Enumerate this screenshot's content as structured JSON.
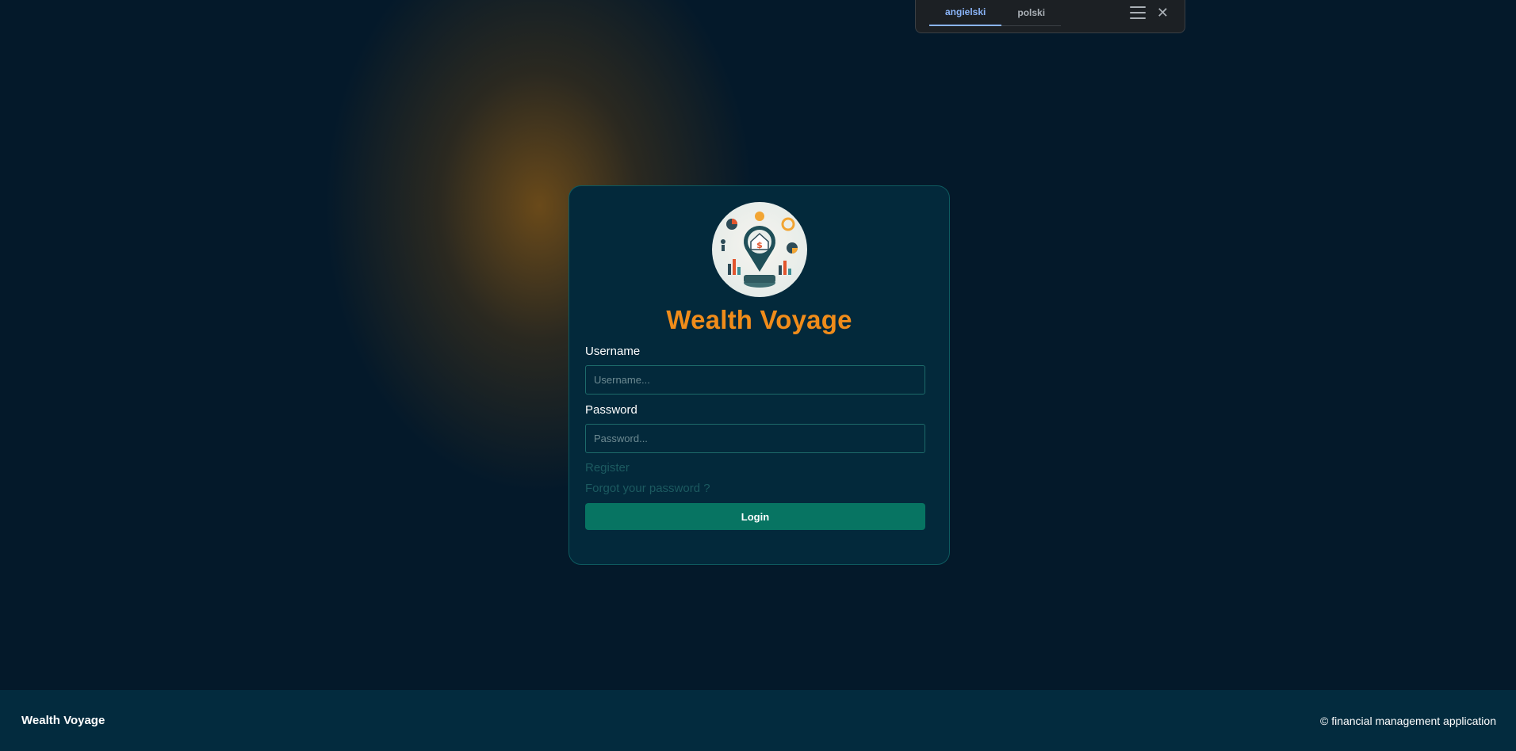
{
  "translate_bar": {
    "tabs": [
      {
        "label": "angielski",
        "active": true
      },
      {
        "label": "polski",
        "active": false
      }
    ],
    "icons": [
      "menu-icon",
      "close-icon"
    ]
  },
  "login": {
    "app_name": "Wealth Voyage",
    "username_label": "Username",
    "username_placeholder": "Username...",
    "username_value": "",
    "password_label": "Password",
    "password_placeholder": "Password...",
    "password_value": "",
    "register_link": "Register",
    "forgot_link": "Forgot your password ?",
    "login_button": "Login"
  },
  "footer": {
    "brand": "Wealth Voyage",
    "copyright": "© financial management application"
  },
  "colors": {
    "accent": "#f08c1a",
    "button": "#077462",
    "card": "#03293b",
    "background": "#04192a"
  }
}
